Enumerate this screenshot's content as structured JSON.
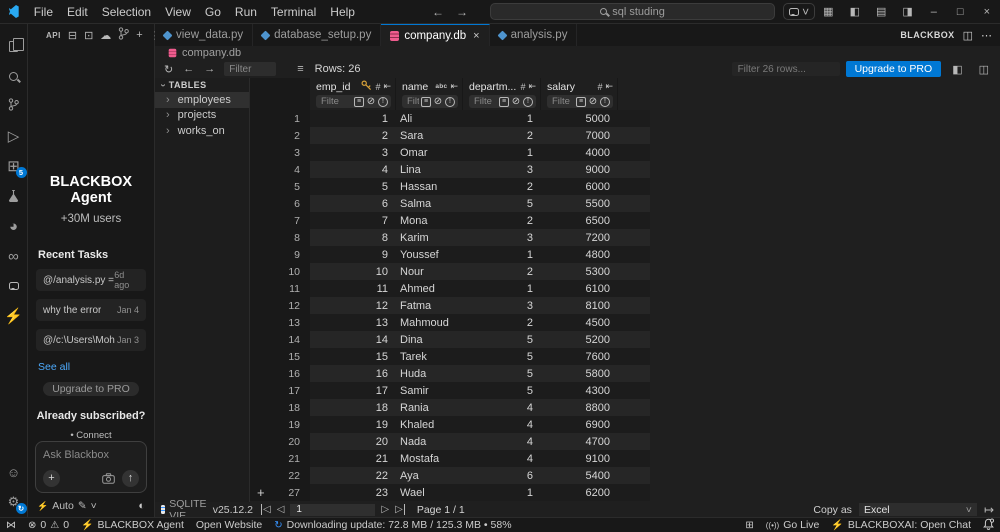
{
  "colors": {
    "accent": "#0078d4",
    "db_pink": "#ef5c8e",
    "key_gold": "#d7a139",
    "bolt_orange": "#e8912d",
    "sync_blue": "#3794ff"
  },
  "titlebar": {
    "menus": [
      "File",
      "Edit",
      "Selection",
      "View",
      "Go",
      "Run",
      "Terminal",
      "Help"
    ],
    "search_value": "sql studing"
  },
  "sidebar_header": {
    "api_label": "API"
  },
  "blackbox": {
    "title": "BLACKBOX Agent",
    "subtitle": "+30M users",
    "recent_header": "Recent Tasks",
    "tasks": [
      {
        "label": "@/analysis.py =...",
        "time": "6d ago"
      },
      {
        "label": "why the error",
        "time": "Jan 4"
      },
      {
        "label": "@/c:\\Users\\Moha...",
        "time": "Jan 3"
      }
    ],
    "see_all": "See all",
    "upgrade_label": "Upgrade to PRO",
    "already_subscribed": "Already subscribed?",
    "connect": "• Connect",
    "ask_placeholder": "Ask Blackbox",
    "mode": "Auto"
  },
  "tabs": [
    {
      "label": "view_data.py",
      "icon": "python",
      "active": false
    },
    {
      "label": "database_setup.py",
      "icon": "python",
      "active": false
    },
    {
      "label": "company.db",
      "icon": "database",
      "active": true,
      "closable": true
    },
    {
      "label": "analysis.py",
      "icon": "python",
      "active": false
    }
  ],
  "editor_actions": {
    "blackbox_label": "BLACKBOX"
  },
  "breadcrumb": {
    "file": "company.db"
  },
  "sqlite": {
    "toolbar": {
      "filter_placeholder": "Filter",
      "rows_label": "Rows: 26",
      "filter_rows_placeholder": "Filter 26 rows...",
      "upgrade_label": "Upgrade to PRO"
    },
    "tables_header": "TABLES",
    "tables": [
      {
        "name": "employees",
        "selected": true
      },
      {
        "name": "projects",
        "selected": false
      },
      {
        "name": "works_on",
        "selected": false
      }
    ],
    "grid": {
      "filter_placeholder": "Filte",
      "columns": [
        {
          "label": "emp_id",
          "icons": [
            "key",
            "number",
            "pin"
          ],
          "align": "right"
        },
        {
          "label": "name",
          "icons": [
            "text",
            "pin"
          ],
          "align": "left"
        },
        {
          "label": "departm...",
          "icons": [
            "number",
            "pin"
          ],
          "align": "right"
        },
        {
          "label": "salary",
          "icons": [
            "number",
            "pin"
          ],
          "align": "right"
        }
      ],
      "rows": [
        [
          1,
          "Ali",
          1,
          5000
        ],
        [
          2,
          "Sara",
          2,
          7000
        ],
        [
          3,
          "Omar",
          1,
          4000
        ],
        [
          4,
          "Lina",
          3,
          9000
        ],
        [
          5,
          "Hassan",
          2,
          6000
        ],
        [
          6,
          "Salma",
          5,
          5500
        ],
        [
          7,
          "Mona",
          2,
          6500
        ],
        [
          8,
          "Karim",
          3,
          7200
        ],
        [
          9,
          "Youssef",
          1,
          4800
        ],
        [
          10,
          "Nour",
          2,
          5300
        ],
        [
          11,
          "Ahmed",
          1,
          6100
        ],
        [
          12,
          "Fatma",
          3,
          8100
        ],
        [
          13,
          "Mahmoud",
          2,
          4500
        ],
        [
          14,
          "Dina",
          5,
          5200
        ],
        [
          15,
          "Tarek",
          5,
          7600
        ],
        [
          16,
          "Huda",
          5,
          5800
        ],
        [
          17,
          "Samir",
          5,
          4300
        ],
        [
          18,
          "Rania",
          4,
          8800
        ],
        [
          19,
          "Khaled",
          4,
          6900
        ],
        [
          20,
          "Nada",
          4,
          4700
        ],
        [
          21,
          "Mostafa",
          4,
          9100
        ],
        [
          22,
          "Aya",
          6,
          5400
        ],
        [
          23,
          "Wael",
          1,
          6200
        ]
      ],
      "add_row_label": "27"
    },
    "pagination": {
      "page_value": "1",
      "page_label": "Page 1 / 1"
    },
    "extension": {
      "name": "SQLITE VIE...",
      "version": "v25.12.2"
    },
    "copy_as": {
      "label": "Copy as",
      "format": "Excel"
    }
  },
  "status_bar": {
    "errors": "0",
    "warnings": "0",
    "blackbox_agent": "BLACKBOX Agent",
    "open_website": "Open Website",
    "download": "Downloading update: 72.8 MB / 125.3 MB • 58%",
    "go_live": "Go Live",
    "open_chat": "BLACKBOXAI: Open Chat"
  }
}
